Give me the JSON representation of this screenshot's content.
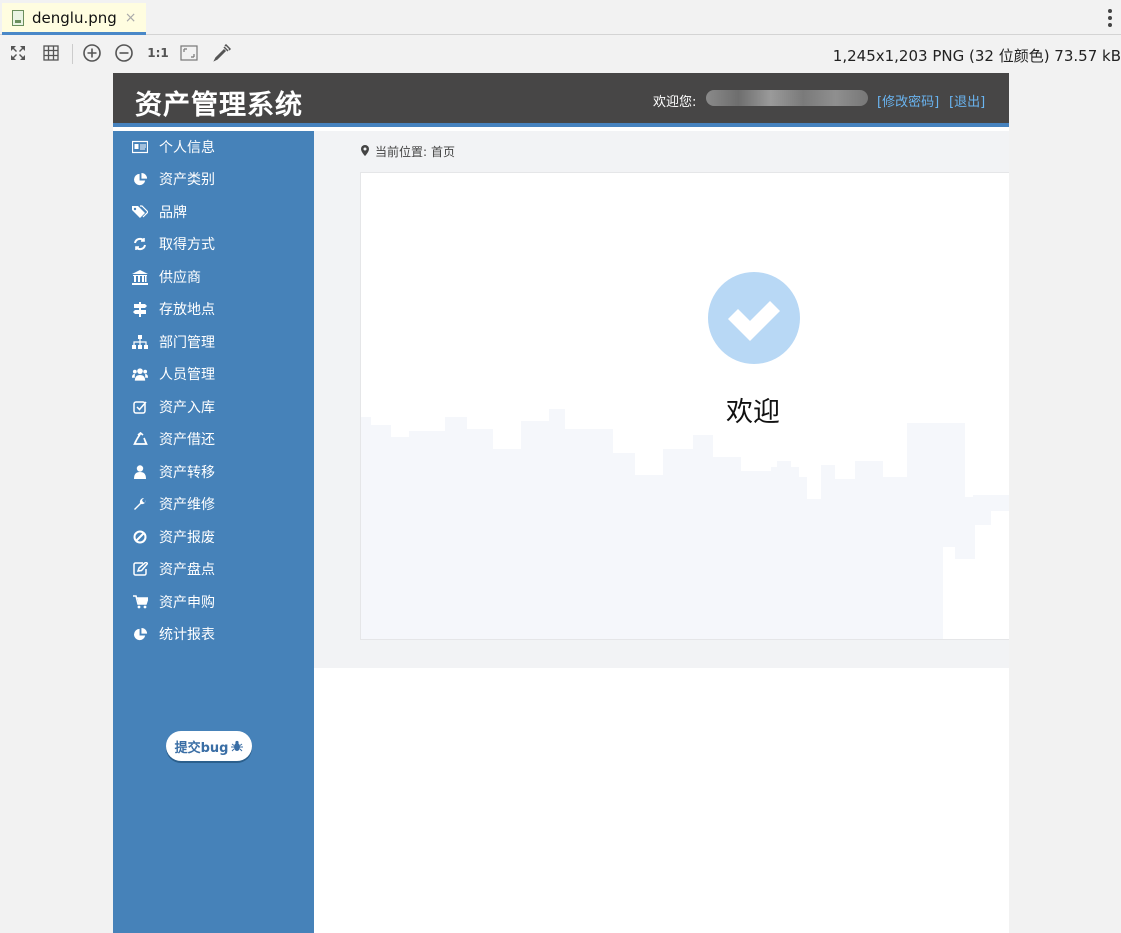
{
  "viewer": {
    "tab_label": "denglu.png",
    "tab_close": "×",
    "toolbar": {
      "icons": [
        "fit-icon",
        "grid-icon",
        "zoom-in-icon",
        "zoom-out-icon",
        "actual-size-icon",
        "fit-window-icon",
        "color-picker-icon"
      ],
      "actual_size_label": "1:1",
      "image_info": "1,245x1,203 PNG (32 位颜色) 73.57 kB"
    }
  },
  "app": {
    "title": "资产管理系统",
    "header": {
      "welcome": "欢迎您:",
      "change_password": "[修改密码]",
      "logout": "[退出]"
    },
    "sidebar": {
      "items": [
        {
          "label": "个人信息",
          "icon": "id-card-icon"
        },
        {
          "label": "资产类别",
          "icon": "pie-chart-icon"
        },
        {
          "label": "品牌",
          "icon": "tags-icon"
        },
        {
          "label": "取得方式",
          "icon": "refresh-icon"
        },
        {
          "label": "供应商",
          "icon": "bank-icon"
        },
        {
          "label": "存放地点",
          "icon": "signpost-icon"
        },
        {
          "label": "部门管理",
          "icon": "sitemap-icon"
        },
        {
          "label": "人员管理",
          "icon": "users-icon"
        },
        {
          "label": "资产入库",
          "icon": "check-square-icon"
        },
        {
          "label": "资产借还",
          "icon": "recycle-icon"
        },
        {
          "label": "资产转移",
          "icon": "user-icon"
        },
        {
          "label": "资产维修",
          "icon": "wrench-icon"
        },
        {
          "label": "资产报废",
          "icon": "ban-icon"
        },
        {
          "label": "资产盘点",
          "icon": "edit-icon"
        },
        {
          "label": "资产申购",
          "icon": "cart-icon"
        },
        {
          "label": "统计报表",
          "icon": "pie-chart-icon"
        }
      ],
      "bug_button": "提交bug"
    },
    "breadcrumb": {
      "prefix": "当前位置:",
      "current": "首页"
    },
    "main": {
      "welcome_title": "欢迎"
    },
    "colors": {
      "header_bg": "#474646",
      "sidebar_bg": "#4682b9",
      "accent": "#4682be",
      "link": "#6ab4f0",
      "check_circle": "#b8d8f5"
    }
  }
}
